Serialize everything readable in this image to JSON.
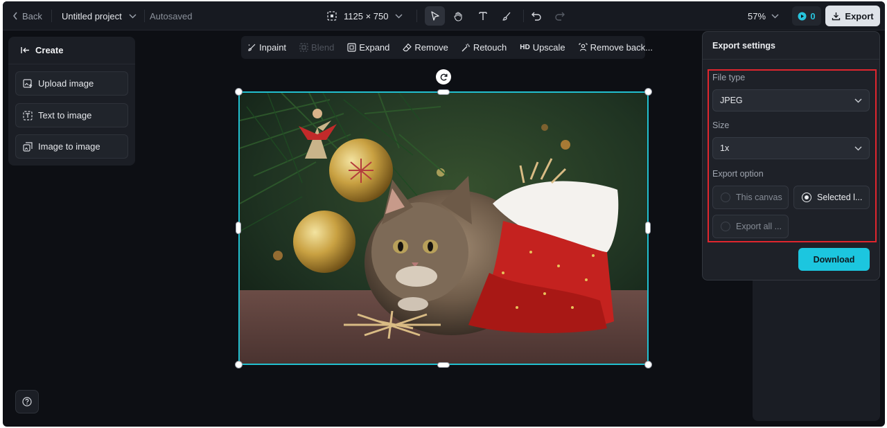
{
  "topbar": {
    "back_label": "Back",
    "project_title": "Untitled project",
    "autosave_status": "Autosaved",
    "canvas_dimensions": "1125 × 750",
    "zoom_level": "57%",
    "credits_count": "0",
    "export_label": "Export"
  },
  "left_panel": {
    "header": "Create",
    "items": [
      {
        "label": "Upload image",
        "icon": "upload-image-icon"
      },
      {
        "label": "Text to image",
        "icon": "text-to-image-icon"
      },
      {
        "label": "Image to image",
        "icon": "image-to-image-icon"
      }
    ]
  },
  "canvas_toolbar": {
    "items": [
      {
        "label": "Inpaint",
        "enabled": true
      },
      {
        "label": "Blend",
        "enabled": false
      },
      {
        "label": "Expand",
        "enabled": true
      },
      {
        "label": "Remove",
        "enabled": true
      },
      {
        "label": "Retouch",
        "enabled": true
      },
      {
        "label": "Upscale",
        "prefix": "HD",
        "enabled": true
      },
      {
        "label": "Remove back...",
        "enabled": true
      }
    ]
  },
  "export_settings": {
    "title": "Export settings",
    "file_type_label": "File type",
    "file_type_value": "JPEG",
    "size_label": "Size",
    "size_value": "1x",
    "export_option_label": "Export option",
    "options": [
      {
        "label": "This canvas",
        "selected": false
      },
      {
        "label": "Selected l...",
        "selected": true
      },
      {
        "label": "Export all ...",
        "selected": false
      }
    ],
    "download_label": "Download"
  },
  "colors": {
    "accent": "#1cc6df",
    "selection_border": "#22c0d0",
    "highlight_box": "#e0262e",
    "background": "#0d0f14"
  }
}
